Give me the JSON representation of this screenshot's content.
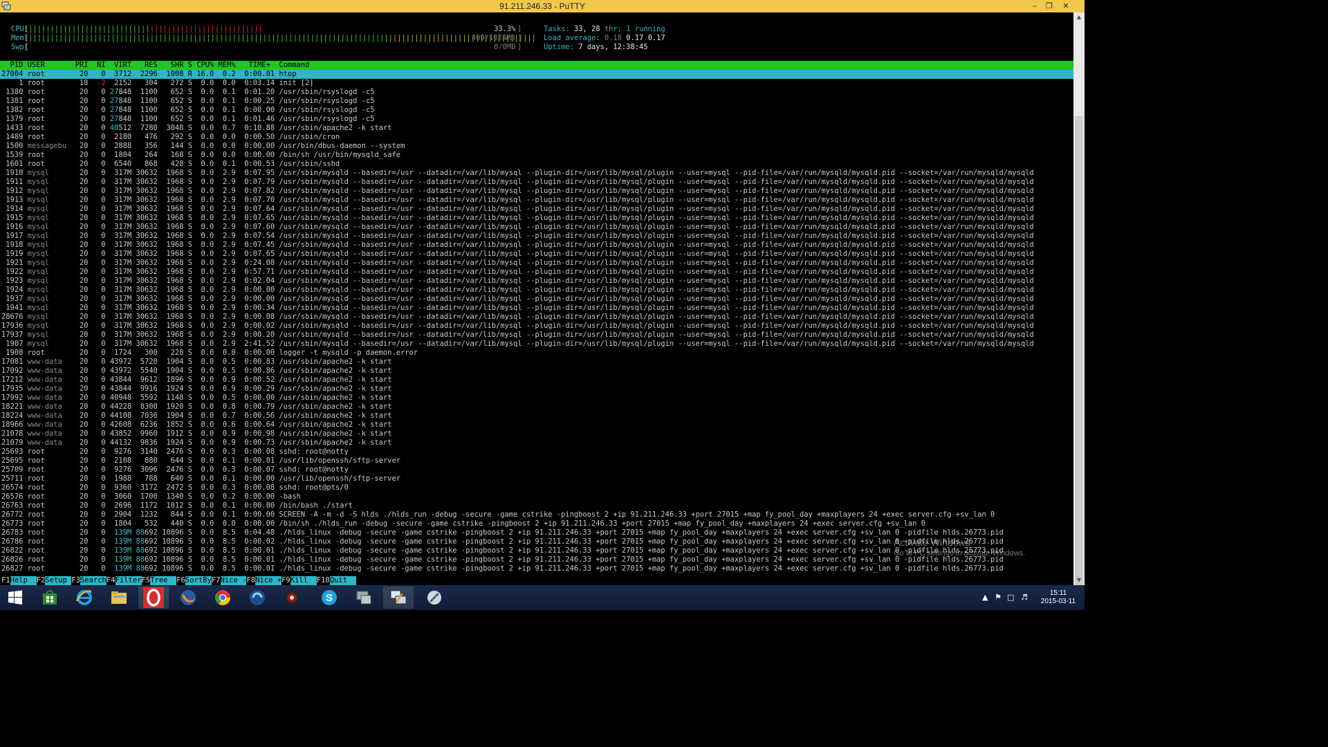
{
  "window": {
    "title": "91.211.246.33 - PuTTY",
    "minimize_icon": "minimize-icon",
    "maximize_icon": "restore-icon",
    "close_icon": "close-icon"
  },
  "meters": {
    "cpu_label": "CPU",
    "cpu_value": "33.3%",
    "mem_label": "Mem",
    "mem_value": "499/1024MB",
    "swp_label": "Swp",
    "swp_value": "0/0MB"
  },
  "summary": {
    "tasks_label": "Tasks:",
    "tasks": "33,",
    "thr": "28",
    "thr_label": "thr;",
    "running": "1",
    "running_label": "running",
    "load_label": "Load average:",
    "load1": "0.18",
    "load5": "0.17",
    "load15": "0.17",
    "uptime_label": "Uptime:",
    "uptime": "7 days, 12:38:45"
  },
  "table": {
    "columns": [
      "PID",
      "USER",
      "PRI",
      "NI",
      "VIRT",
      "RES",
      "SHR",
      "S",
      "CPU%",
      "MEM%",
      "TIME+",
      "Command"
    ],
    "header_line": "  PID USER       PRI  NI  VIRT   RES   SHR S CPU% MEM%   TIME+  Command",
    "selected_line": "27004 root        20   0  3712  2296  1008 R 16.0  0.2  0:00.01 htop",
    "rows": [
      "    1 root        18  -2  2152   304   272 S  0.0  0.0  0:03.14 init [2]",
      " 1380 root        20   0 27848  1100   652 S  0.0  0.1  0:01.20 /usr/sbin/rsyslogd -c5",
      " 1381 root        20   0 27848  1100   652 S  0.0  0.1  0:00.25 /usr/sbin/rsyslogd -c5",
      " 1382 root        20   0 27848  1100   652 S  0.0  0.1  0:00.00 /usr/sbin/rsyslogd -c5",
      " 1379 root        20   0 27848  1100   652 S  0.0  0.1  0:01.46 /usr/sbin/rsyslogd -c5",
      " 1433 root        20   0 40512  7280  3048 S  0.0  0.7  0:10.88 /usr/sbin/apache2 -k start",
      " 1489 root        20   0  2180   476   292 S  0.0  0.0  0:00.50 /usr/sbin/cron",
      " 1500 messagebu   20   0  2888   356   144 S  0.0  0.0  0:00.00 /usr/bin/dbus-daemon --system",
      " 1539 root        20   0  1804   264   168 S  0.0  0.0  0:00.00 /bin/sh /usr/bin/mysqld_safe",
      " 1601 root        20   0  6540   868   428 S  0.0  0.1  0:00.53 /usr/sbin/sshd",
      " 1910 mysql       20   0  317M 30632  1968 S  0.0  2.9  0:07.95 /usr/sbin/mysqld --basedir=/usr --datadir=/var/lib/mysql --plugin-dir=/usr/lib/mysql/plugin --user=mysql --pid-file=/var/run/mysqld/mysqld.pid --socket=/var/run/mysqld/mysqld",
      " 1911 mysql       20   0  317M 30632  1968 S  0.0  2.9  0:07.79 /usr/sbin/mysqld --basedir=/usr --datadir=/var/lib/mysql --plugin-dir=/usr/lib/mysql/plugin --user=mysql --pid-file=/var/run/mysqld/mysqld.pid --socket=/var/run/mysqld/mysqld",
      " 1912 mysql       20   0  317M 30632  1968 S  0.0  2.9  0:07.82 /usr/sbin/mysqld --basedir=/usr --datadir=/var/lib/mysql --plugin-dir=/usr/lib/mysql/plugin --user=mysql --pid-file=/var/run/mysqld/mysqld.pid --socket=/var/run/mysqld/mysqld",
      " 1913 mysql       20   0  317M 30632  1968 S  0.0  2.9  0:07.70 /usr/sbin/mysqld --basedir=/usr --datadir=/var/lib/mysql --plugin-dir=/usr/lib/mysql/plugin --user=mysql --pid-file=/var/run/mysqld/mysqld.pid --socket=/var/run/mysqld/mysqld",
      " 1914 mysql       20   0  317M 30632  1968 S  0.0  2.9  0:07.64 /usr/sbin/mysqld --basedir=/usr --datadir=/var/lib/mysql --plugin-dir=/usr/lib/mysql/plugin --user=mysql --pid-file=/var/run/mysqld/mysqld.pid --socket=/var/run/mysqld/mysqld",
      " 1915 mysql       20   0  317M 30632  1968 S  0.0  2.9  0:07.65 /usr/sbin/mysqld --basedir=/usr --datadir=/var/lib/mysql --plugin-dir=/usr/lib/mysql/plugin --user=mysql --pid-file=/var/run/mysqld/mysqld.pid --socket=/var/run/mysqld/mysqld",
      " 1916 mysql       20   0  317M 30632  1968 S  0.0  2.9  0:07.60 /usr/sbin/mysqld --basedir=/usr --datadir=/var/lib/mysql --plugin-dir=/usr/lib/mysql/plugin --user=mysql --pid-file=/var/run/mysqld/mysqld.pid --socket=/var/run/mysqld/mysqld",
      " 1917 mysql       20   0  317M 30632  1968 S  0.0  2.9  0:07.54 /usr/sbin/mysqld --basedir=/usr --datadir=/var/lib/mysql --plugin-dir=/usr/lib/mysql/plugin --user=mysql --pid-file=/var/run/mysqld/mysqld.pid --socket=/var/run/mysqld/mysqld",
      " 1918 mysql       20   0  317M 30632  1968 S  0.0  2.9  0:07.45 /usr/sbin/mysqld --basedir=/usr --datadir=/var/lib/mysql --plugin-dir=/usr/lib/mysql/plugin --user=mysql --pid-file=/var/run/mysqld/mysqld.pid --socket=/var/run/mysqld/mysqld",
      " 1919 mysql       20   0  317M 30632  1968 S  0.0  2.9  0:07.65 /usr/sbin/mysqld --basedir=/usr --datadir=/var/lib/mysql --plugin-dir=/usr/lib/mysql/plugin --user=mysql --pid-file=/var/run/mysqld/mysqld.pid --socket=/var/run/mysqld/mysqld",
      " 1921 mysql       20   0  317M 30632  1968 S  0.0  2.9  0:24.08 /usr/sbin/mysqld --basedir=/usr --datadir=/var/lib/mysql --plugin-dir=/usr/lib/mysql/plugin --user=mysql --pid-file=/var/run/mysqld/mysqld.pid --socket=/var/run/mysqld/mysqld",
      " 1922 mysql       20   0  317M 30632  1968 S  0.0  2.9  0:57.71 /usr/sbin/mysqld --basedir=/usr --datadir=/var/lib/mysql --plugin-dir=/usr/lib/mysql/plugin --user=mysql --pid-file=/var/run/mysqld/mysqld.pid --socket=/var/run/mysqld/mysqld",
      " 1923 mysql       20   0  317M 30632  1968 S  0.0  2.9  0:02.04 /usr/sbin/mysqld --basedir=/usr --datadir=/var/lib/mysql --plugin-dir=/usr/lib/mysql/plugin --user=mysql --pid-file=/var/run/mysqld/mysqld.pid --socket=/var/run/mysqld/mysqld",
      " 1924 mysql       20   0  317M 30632  1968 S  0.0  2.9  0:00.00 /usr/sbin/mysqld --basedir=/usr --datadir=/var/lib/mysql --plugin-dir=/usr/lib/mysql/plugin --user=mysql --pid-file=/var/run/mysqld/mysqld.pid --socket=/var/run/mysqld/mysqld",
      " 1937 mysql       20   0  317M 30632  1968 S  0.0  2.9  0:00.00 /usr/sbin/mysqld --basedir=/usr --datadir=/var/lib/mysql --plugin-dir=/usr/lib/mysql/plugin --user=mysql --pid-file=/var/run/mysqld/mysqld.pid --socket=/var/run/mysqld/mysqld",
      " 1941 mysql       20   0  317M 30632  1968 S  0.0  2.9  0:00.34 /usr/sbin/mysqld --basedir=/usr --datadir=/var/lib/mysql --plugin-dir=/usr/lib/mysql/plugin --user=mysql --pid-file=/var/run/mysqld/mysqld.pid --socket=/var/run/mysqld/mysqld",
      "28676 mysql       20   0  317M 30632  1968 S  0.0  2.9  0:00.08 /usr/sbin/mysqld --basedir=/usr --datadir=/var/lib/mysql --plugin-dir=/usr/lib/mysql/plugin --user=mysql --pid-file=/var/run/mysqld/mysqld.pid --socket=/var/run/mysqld/mysqld",
      "17936 mysql       20   0  317M 30632  1968 S  0.0  2.9  0:00.02 /usr/sbin/mysqld --basedir=/usr --datadir=/var/lib/mysql --plugin-dir=/usr/lib/mysql/plugin --user=mysql --pid-file=/var/run/mysqld/mysqld.pid --socket=/var/run/mysqld/mysqld",
      "17937 mysql       20   0  317M 30632  1968 S  0.0  2.9  0:00.20 /usr/sbin/mysqld --basedir=/usr --datadir=/var/lib/mysql --plugin-dir=/usr/lib/mysql/plugin --user=mysql --pid-file=/var/run/mysqld/mysqld.pid --socket=/var/run/mysqld/mysqld",
      " 1907 mysql       20   0  317M 30632  1968 S  0.0  2.9  2:41.52 /usr/sbin/mysqld --basedir=/usr --datadir=/var/lib/mysql --plugin-dir=/usr/lib/mysql/plugin --user=mysql --pid-file=/var/run/mysqld/mysqld.pid --socket=/var/run/mysqld/mysqld",
      " 1908 root        20   0  1724   300   228 S  0.0  0.0  0:00.00 logger -t mysqld -p daemon.error",
      "17081 www-data    20   0 43972  5720  1904 S  0.0  0.5  0:00.83 /usr/sbin/apache2 -k start",
      "17092 www-data    20   0 43972  5540  1904 S  0.0  0.5  0:00.86 /usr/sbin/apache2 -k start",
      "17212 www-data    20   0 43844  9612  1896 S  0.0  0.9  0:00.52 /usr/sbin/apache2 -k start",
      "17935 www-data    20   0 43844  9916  1924 S  0.0  0.9  0:00.29 /usr/sbin/apache2 -k start",
      "17992 www-data    20   0 40948  5592  1148 S  0.0  0.5  0:00.00 /usr/sbin/apache2 -k start",
      "18221 www-data    20   0 44228  8300  1920 S  0.0  0.8  0:00.79 /usr/sbin/apache2 -k start",
      "18224 www-data    20   0 44108  7036  1904 S  0.0  0.7  0:00.56 /usr/sbin/apache2 -k start",
      "18966 www-data    20   0 42608  6236  1852 S  0.0  0.6  0:00.64 /usr/sbin/apache2 -k start",
      "21078 www-data    20   0 43852  9960  1912 S  0.0  0.9  0:00.98 /usr/sbin/apache2 -k start",
      "21079 www-data    20   0 44132  9836  1924 S  0.0  0.9  0:00.73 /usr/sbin/apache2 -k start",
      "25693 root        20   0  9276  3140  2476 S  0.0  0.3  0:00.08 sshd: root@notty",
      "25695 root        20   0  2108   880   644 S  0.0  0.1  0:00.01 /usr/lib/openssh/sftp-server",
      "25709 root        20   0  9276  3096  2476 S  0.0  0.3  0:00.07 sshd: root@notty",
      "25711 root        20   0  1988   788   640 S  0.0  0.1  0:00.00 /usr/lib/openssh/sftp-server",
      "26574 root        20   0  9360  3172  2472 S  0.0  0.3  0:00.08 sshd: root@pts/0",
      "26576 root        20   0  3060  1700  1340 S  0.0  0.2  0:00.00 -bash",
      "26763 root        20   0  2696  1172  1012 S  0.0  0.1  0:00.00 /bin/bash ./start",
      "26772 root        20   0  2904  1232   844 S  0.0  0.1  0:00.00 SCREEN -A -m -d -S hlds ./hlds_run -debug -secure -game cstrike -pingboost 2 +ip 91.211.246.33 +port 27015 +map fy_pool_day +maxplayers 24 +exec server.cfg +sv_lan 0",
      "26773 root        20   0  1804   532   440 S  0.0  0.0  0:00.00 /bin/sh ./hlds_run -debug -secure -game cstrike -pingboost 2 +ip 91.211.246.33 +port 27015 +map fy_pool_day +maxplayers 24 +exec server.cfg +sv_lan 0",
      "26783 root        20   0  139M 88692 10896 S  0.0  8.5  0:04.48 ./hlds_linux -debug -secure -game cstrike -pingboost 2 +ip 91.211.246.33 +port 27015 +map fy_pool_day +maxplayers 24 +exec server.cfg +sv_lan 0 -pidfile hlds.26773.pid",
      "26786 root        20   0  139M 88692 10896 S  0.0  8.5  0:00.02 ./hlds_linux -debug -secure -game cstrike -pingboost 2 +ip 91.211.246.33 +port 27015 +map fy_pool_day +maxplayers 24 +exec server.cfg +sv_lan 0 -pidfile hlds.26773.pid",
      "26822 root        20   0  139M 88692 10896 S  0.0  8.5  0:00.01 ./hlds_linux -debug -secure -game cstrike -pingboost 2 +ip 91.211.246.33 +port 27015 +map fy_pool_day +maxplayers 24 +exec server.cfg +sv_lan 0 -pidfile hlds.26773.pid",
      "26826 root        20   0  139M 88692 10896 S  0.0  8.5  0:00.01 ./hlds_linux -debug -secure -game cstrike -pingboost 2 +ip 91.211.246.33 +port 27015 +map fy_pool_day +maxplayers 24 +exec server.cfg +sv_lan 0 -pidfile hlds.26773.pid",
      "26827 root        20   0  139M 88692 10896 S  0.0  8.5  0:00.01 ./hlds_linux -debug -secure -game cstrike -pingboost 2 +ip 91.211.246.33 +port 27015 +map fy_pool_day +maxplayers 24 +exec server.cfg +sv_lan 0 -pidfile hlds.26773.pid"
    ]
  },
  "fkeys": [
    {
      "key": "F1",
      "label": "Help  "
    },
    {
      "key": "F2",
      "label": "Setup "
    },
    {
      "key": "F3",
      "label": "Search"
    },
    {
      "key": "F4",
      "label": "Filter"
    },
    {
      "key": "F5",
      "label": "Tree  "
    },
    {
      "key": "F6",
      "label": "SortBy"
    },
    {
      "key": "F7",
      "label": "Nice -"
    },
    {
      "key": "F8",
      "label": "Nice +"
    },
    {
      "key": "F9",
      "label": "Kill  "
    },
    {
      "key": "F10",
      "label": "Quit  "
    }
  ],
  "watermark": {
    "line1": "Activate Windows",
    "line2": "Go to PC settings to activate Windows."
  },
  "taskbar": {
    "apps": [
      "start-icon",
      "store-icon",
      "ie-icon",
      "file-explorer-icon",
      "opera-icon",
      "firefox-icon",
      "chrome-icon",
      "cyberfox-icon",
      "media-icon",
      "skype-icon",
      "remote-icon",
      "putty-icon",
      "tool-icon"
    ],
    "time": "15:11",
    "date": "2015-03-11"
  },
  "colors": {
    "title_bar": "#f2c84b",
    "header_green": "#22c522",
    "selection_cyan": "#2fb5c4",
    "terminal_bg": "#000000"
  }
}
